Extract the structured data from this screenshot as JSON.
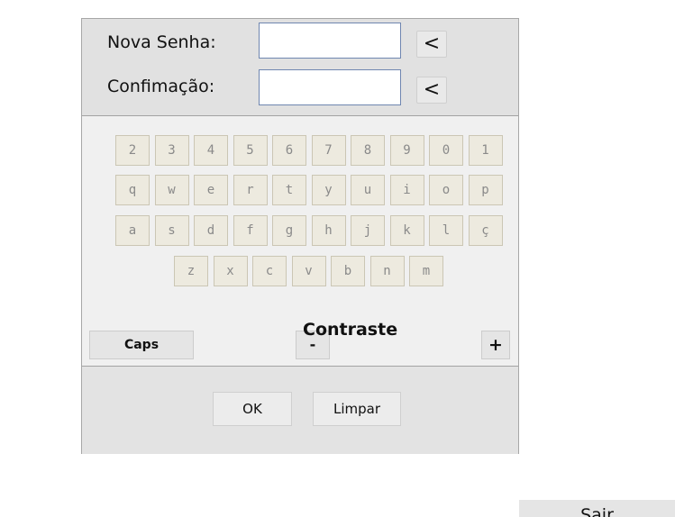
{
  "password_form": {
    "new_password_label": "Nova Senha:",
    "new_password_value": "",
    "confirm_label": "Confimação:",
    "confirm_value": "",
    "backspace_label": "<"
  },
  "keyboard": {
    "rows": [
      [
        "2",
        "3",
        "4",
        "5",
        "6",
        "7",
        "8",
        "9",
        "0",
        "1"
      ],
      [
        "q",
        "w",
        "e",
        "r",
        "t",
        "y",
        "u",
        "i",
        "o",
        "p"
      ],
      [
        "a",
        "s",
        "d",
        "f",
        "g",
        "h",
        "j",
        "k",
        "l",
        "ç"
      ],
      [
        "z",
        "x",
        "c",
        "v",
        "b",
        "n",
        "m"
      ]
    ],
    "caps_label": "Caps",
    "contrast_decrease_label": "-",
    "contrast_label": "Contraste",
    "contrast_increase_label": "+"
  },
  "actions": {
    "ok_label": "OK",
    "clear_label": "Limpar"
  },
  "footer": {
    "exit_label": "Sair"
  }
}
